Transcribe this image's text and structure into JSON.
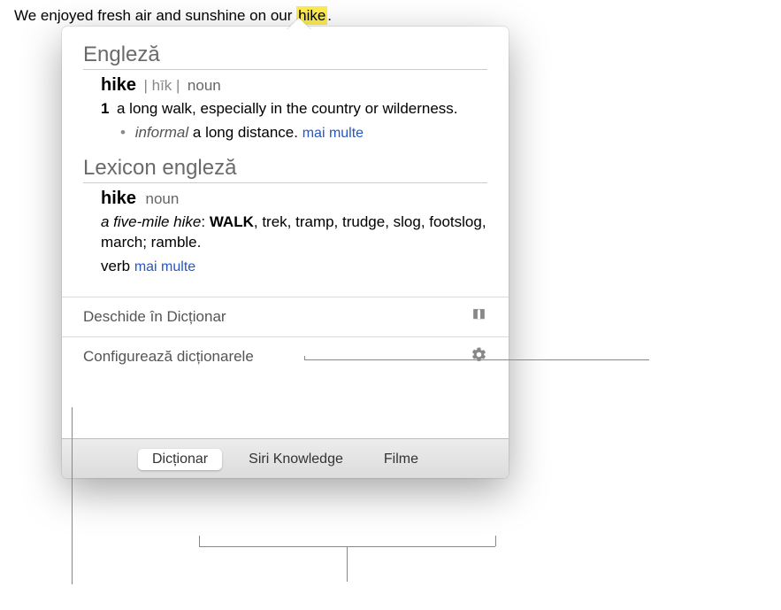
{
  "source": {
    "prefix": "We enjoyed fresh air and sunshine on our ",
    "highlighted": "hike",
    "suffix": "."
  },
  "dictionary": {
    "section_title": "Engleză",
    "headword": "hike",
    "pronunciation": "| hīk |",
    "pos": "noun",
    "sense_num": "1",
    "sense_text": "a long walk, especially in the country or wilderness.",
    "sub_label": "informal",
    "sub_text": "a long distance.",
    "more": "mai multe"
  },
  "thesaurus": {
    "section_title": "Lexicon engleză",
    "headword": "hike",
    "pos": "noun",
    "example_prefix": "a five-mile hike",
    "primary": "WALK",
    "rest": ", trek, tramp, trudge, slog, footslog, march; ramble.",
    "verb_label": "verb",
    "more": "mai multe"
  },
  "actions": {
    "open_label": "Deschide în Dicționar",
    "configure_label": "Configurează dicționarele"
  },
  "tabs": {
    "dict": "Dicționar",
    "siri": "Siri Knowledge",
    "films": "Filme"
  }
}
